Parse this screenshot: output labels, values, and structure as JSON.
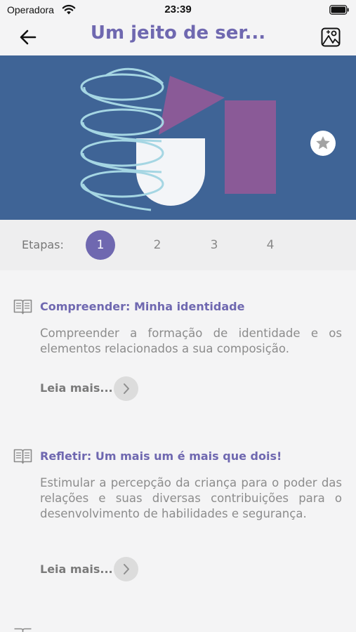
{
  "status_bar": {
    "carrier": "Operadora",
    "time": "23:39",
    "wifi_icon": "wifi-icon",
    "battery_icon": "battery-icon"
  },
  "nav": {
    "title": "Um jeito de ser...",
    "back_icon": "arrow-left-icon",
    "gallery_icon": "image-gallery-icon"
  },
  "hero": {
    "background_color": "#3f6496",
    "favorite_icon": "star-icon"
  },
  "steps": {
    "label": "Etapas:",
    "items": [
      "1",
      "2",
      "3",
      "4"
    ],
    "active": "1",
    "accent_color": "#6f68b0"
  },
  "cards": [
    {
      "icon": "book-icon",
      "title": "Compreender: Minha identidade",
      "description": "Compreender a formação de identidade e os elementos relacionados a sua composição.",
      "read_more": "Leia mais..."
    },
    {
      "icon": "book-icon",
      "title": "Refletir: Um mais um é mais que dois!",
      "description": "Estimular a percepção da criança para o poder das relações e suas diversas contribuições para o desenvolvimento de habilidades e segurança.",
      "read_more": "Leia mais..."
    }
  ]
}
